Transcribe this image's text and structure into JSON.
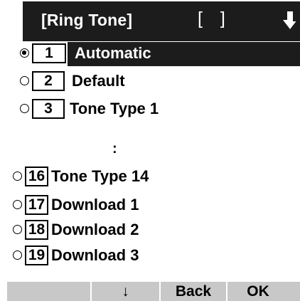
{
  "header": {
    "title": "[Ring Tone]",
    "bracket": "[ ]"
  },
  "items": [
    {
      "number": "1",
      "label": "Automatic",
      "selected": true
    },
    {
      "number": "2",
      "label": "Default",
      "selected": false
    },
    {
      "number": "3",
      "label": "Tone Type 1",
      "selected": false
    },
    {
      "number": "16",
      "label": "Tone Type 14",
      "selected": false
    },
    {
      "number": "17",
      "label": "Download 1",
      "selected": false
    },
    {
      "number": "18",
      "label": "Download 2",
      "selected": false
    },
    {
      "number": "19",
      "label": "Download 3",
      "selected": false
    }
  ],
  "ellipsis": ":",
  "softkeys": [
    "",
    "↓",
    "Back",
    "OK"
  ],
  "colors": {
    "bar": "#1c1c1c",
    "softbar": "#c8c8c8"
  }
}
